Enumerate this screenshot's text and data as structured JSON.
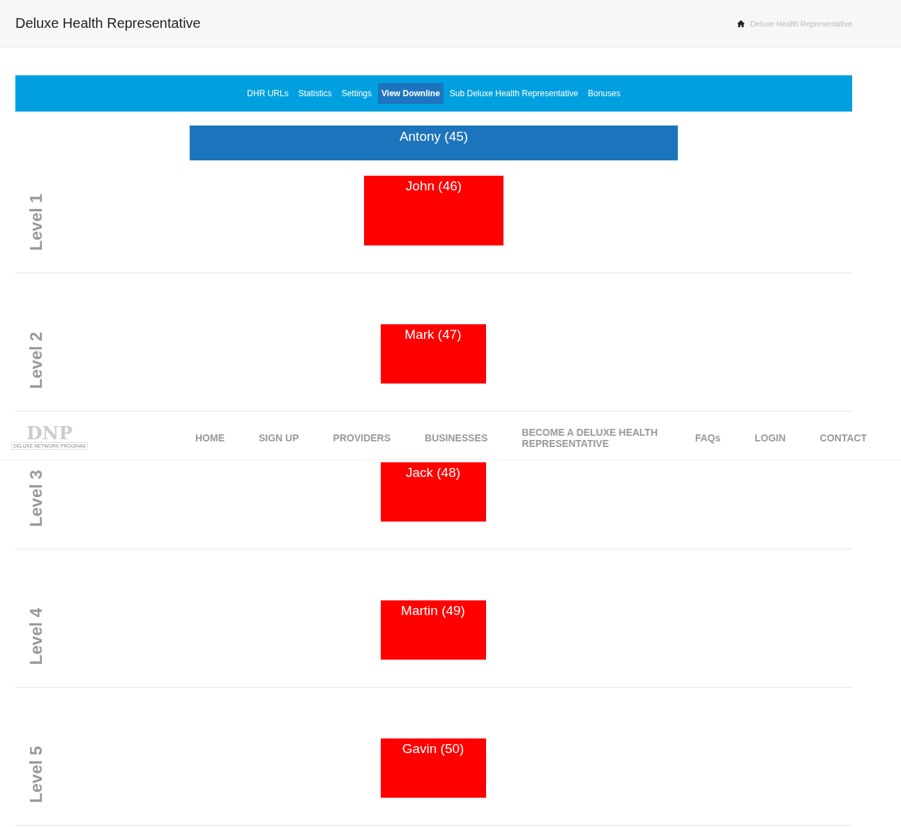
{
  "page_title": "Deluxe Health Representative",
  "breadcrumb": {
    "current": "Deluxe Health Representative"
  },
  "tabs": [
    {
      "label": "DHR URLs",
      "selected": false
    },
    {
      "label": "Statistics",
      "selected": false
    },
    {
      "label": "Settings",
      "selected": false
    },
    {
      "label": "View Downline",
      "selected": true
    },
    {
      "label": "Sub Deluxe Health Representative",
      "selected": false
    },
    {
      "label": "Bonuses",
      "selected": false
    }
  ],
  "root": {
    "name": "Antony (45)"
  },
  "levels": [
    {
      "label": "Level 1",
      "member": "John (46)"
    },
    {
      "label": "Level 2",
      "member": "Mark (47)"
    },
    {
      "label": "Level 3",
      "member": "Jack (48)"
    },
    {
      "label": "Level 4",
      "member": "Martin (49)"
    },
    {
      "label": "Level 5",
      "member": "Gavin (50)"
    }
  ],
  "site_menu": {
    "logo": "DNP",
    "tagline": "DELUXE NETWORK PROGRAM",
    "items": [
      "HOME",
      "SIGN UP",
      "PROVIDERS",
      "BUSINESSES",
      "BECOME A DELUXE HEALTH REPRESENTATIVE",
      "FAQs",
      "LOGIN",
      "CONTACT"
    ]
  }
}
